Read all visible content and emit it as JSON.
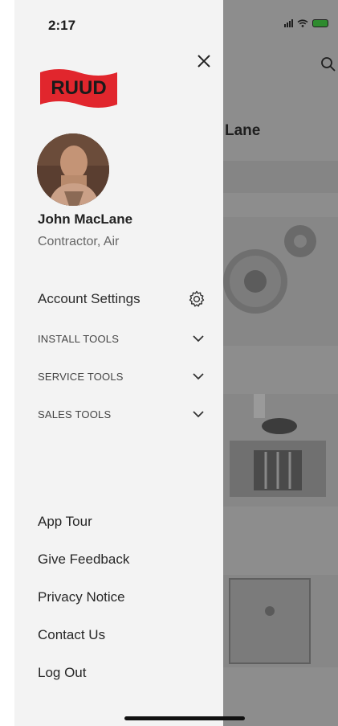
{
  "status_bar": {
    "time": "2:17"
  },
  "brand": {
    "logo_text": "RUUD",
    "logo_color": "#e1262d"
  },
  "profile": {
    "name": "John MacLane",
    "role": "Contractor, Air"
  },
  "menu": {
    "account_settings": "Account Settings",
    "sections": [
      {
        "label": "INSTALL TOOLS",
        "icon": "chevron-down-icon"
      },
      {
        "label": "SERVICE TOOLS",
        "icon": "chevron-down-icon"
      },
      {
        "label": "SALES TOOLS",
        "icon": "chevron-down-icon"
      }
    ]
  },
  "links": [
    "App Tour",
    "Give Feedback",
    "Privacy Notice",
    "Contact Us",
    "Log Out"
  ],
  "background": {
    "name_fragment": "Lane"
  },
  "colors": {
    "drawer_bg": "#f3f3f3",
    "overlay": "#8d8d8d",
    "text": "#262626"
  }
}
